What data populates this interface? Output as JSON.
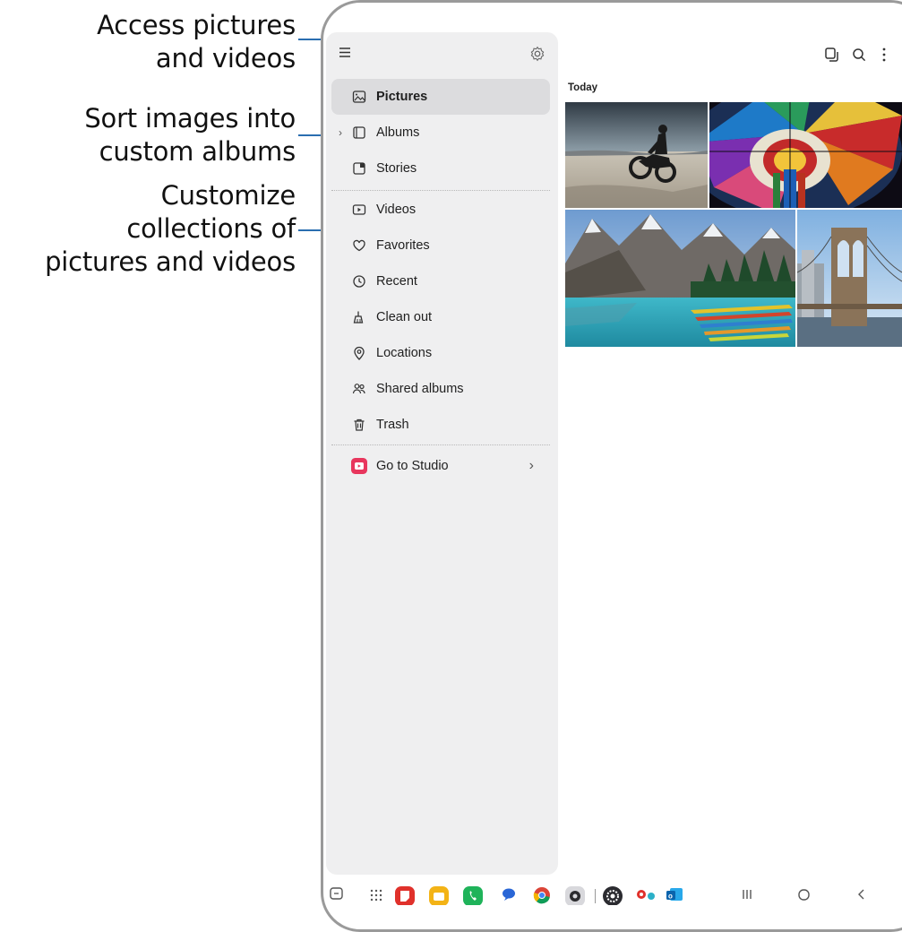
{
  "callouts": [
    {
      "line1": "Access pictures",
      "line2": "and videos"
    },
    {
      "line1": "Sort images into",
      "line2": "custom albums"
    },
    {
      "line1": "Customize",
      "line2": "collections of",
      "line3": "pictures and videos"
    }
  ],
  "drawer": {
    "items": [
      {
        "label": "Pictures",
        "icon": "picture-icon",
        "active": true
      },
      {
        "label": "Albums",
        "icon": "album-icon",
        "expandable": true
      },
      {
        "label": "Stories",
        "icon": "stories-icon"
      },
      {
        "label": "Videos",
        "icon": "video-icon"
      },
      {
        "label": "Favorites",
        "icon": "heart-icon"
      },
      {
        "label": "Recent",
        "icon": "clock-icon"
      },
      {
        "label": "Clean out",
        "icon": "broom-icon"
      },
      {
        "label": "Locations",
        "icon": "location-icon"
      },
      {
        "label": "Shared albums",
        "icon": "people-icon"
      },
      {
        "label": "Trash",
        "icon": "trash-icon"
      }
    ],
    "studio": {
      "label": "Go to Studio",
      "icon": "studio-icon",
      "color": "#e8365d"
    }
  },
  "main": {
    "section_label": "Today"
  },
  "colors": {
    "accent_line": "#2a6eb0",
    "drawer_bg": "#efeff0",
    "active_bg": "#dcdcde"
  }
}
